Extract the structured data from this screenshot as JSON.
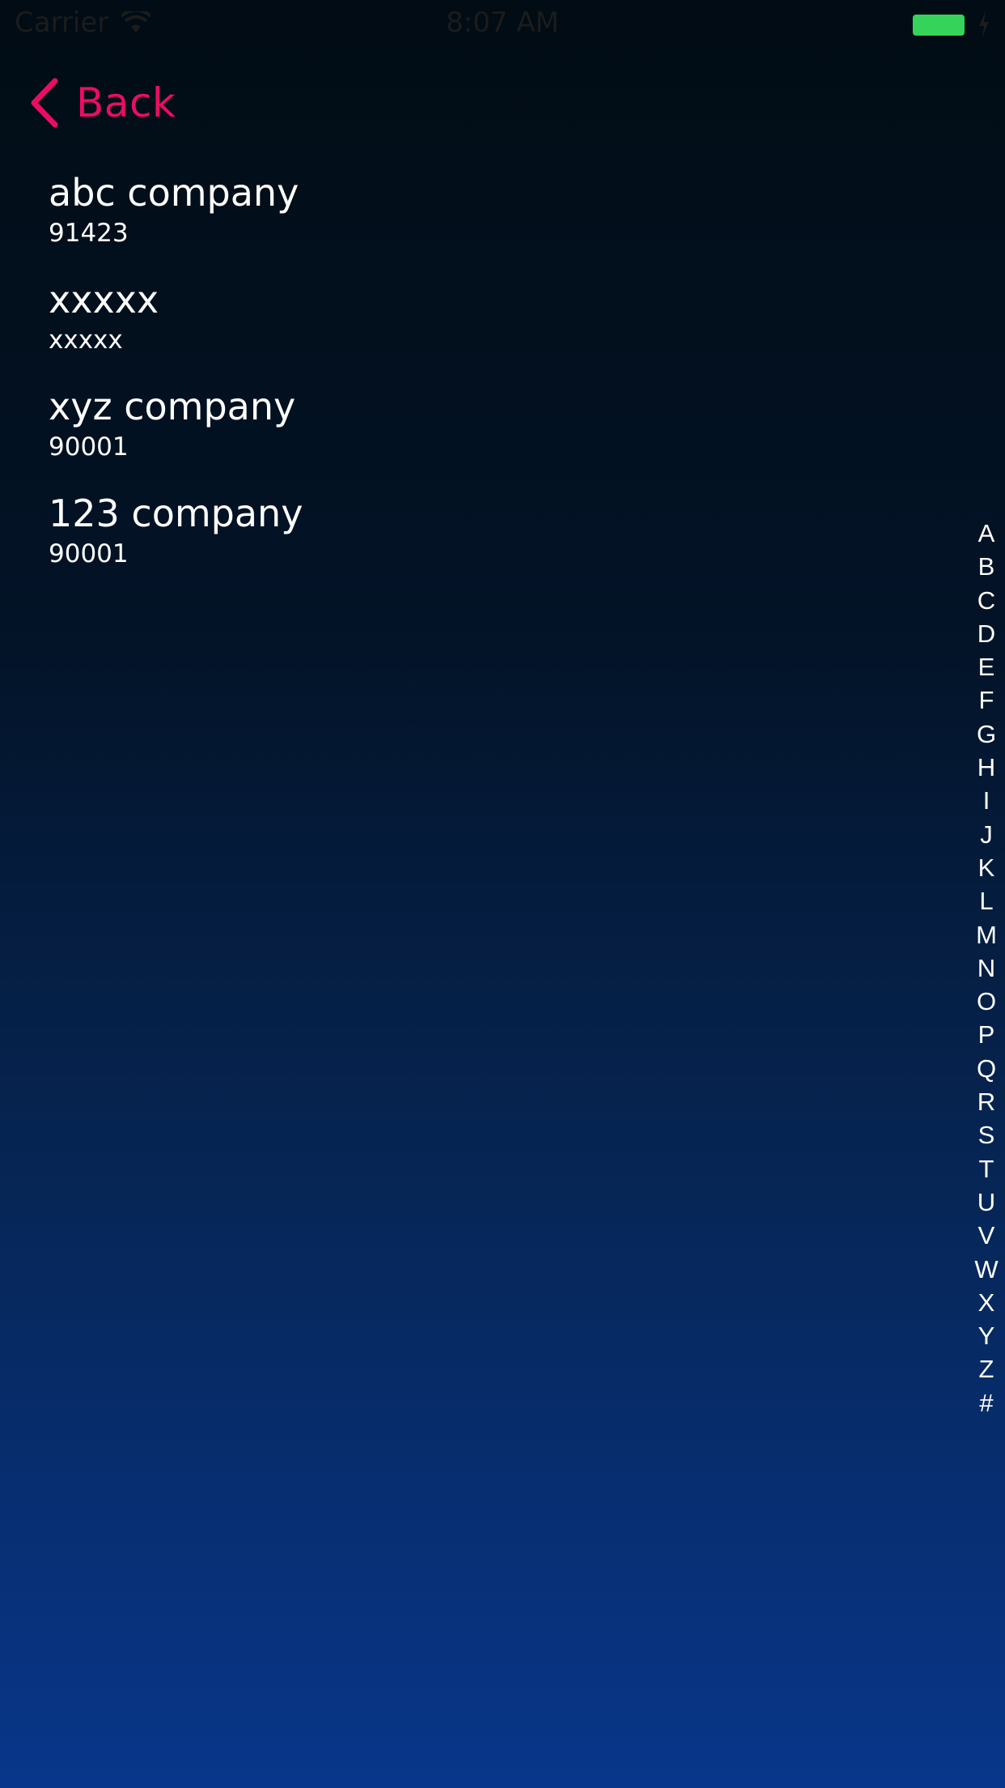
{
  "status_bar": {
    "carrier": "Carrier",
    "time": "8:07 AM",
    "wifi_icon": "wifi-icon",
    "battery_icon": "battery-icon",
    "battery_color": "#35d35a"
  },
  "nav": {
    "back_label": "Back",
    "back_icon": "chevron-left-icon",
    "accent_color": "#ea0d62"
  },
  "list": {
    "items": [
      {
        "title": "abc company",
        "subtitle": "91423"
      },
      {
        "title": "xxxxx",
        "subtitle": "xxxxx"
      },
      {
        "title": "xyz company",
        "subtitle": "90001"
      },
      {
        "title": "123 company",
        "subtitle": "90001"
      }
    ]
  },
  "section_index": [
    "A",
    "B",
    "C",
    "D",
    "E",
    "F",
    "G",
    "H",
    "I",
    "J",
    "K",
    "L",
    "M",
    "N",
    "O",
    "P",
    "Q",
    "R",
    "S",
    "T",
    "U",
    "V",
    "W",
    "X",
    "Y",
    "Z",
    "#"
  ]
}
